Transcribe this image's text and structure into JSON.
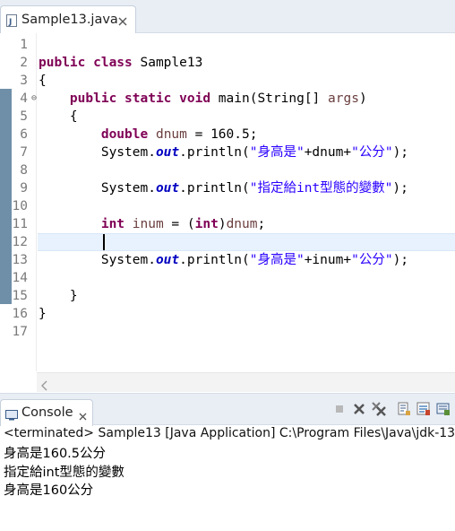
{
  "editor_tab": {
    "label": "Sample13.java",
    "icon": "java-file-icon",
    "close_icon": "close-icon"
  },
  "line_numbers": [
    "1",
    "2",
    "3",
    "4",
    "5",
    "6",
    "7",
    "8",
    "9",
    "10",
    "11",
    "12",
    "13",
    "14",
    "15",
    "16",
    "17"
  ],
  "code": {
    "l2_kw": "public class",
    "l2_name": " Sample13",
    "l3": "{",
    "l4_indent": "    ",
    "l4_kw": "public static void",
    "l4_rest1": " main(String[] ",
    "l4_args": "args",
    "l4_rest2": ")",
    "l5": "    {",
    "l6_indent": "        ",
    "l6_kw": "double",
    "l6_var": " dnum",
    "l6_rest": " = 160.5;",
    "l7_a": "        System.",
    "l7_field": "out",
    "l7_b": ".println(",
    "l7_str1": "\"身高是\"",
    "l7_c": "+dnum+",
    "l7_str2": "\"公分\"",
    "l7_d": ");",
    "l9_a": "        System.",
    "l9_field": "out",
    "l9_b": ".println(",
    "l9_str": "\"指定給int型態的變數\"",
    "l9_c": ");",
    "l11_indent": "        ",
    "l11_kw": "int",
    "l11_var": " inum",
    "l11_a": " = (",
    "l11_kw2": "int",
    "l11_b": ")",
    "l11_var2": "dnum",
    "l11_c": ";",
    "l13_a": "        System.",
    "l13_field": "out",
    "l13_b": ".println(",
    "l13_str1": "\"身高是\"",
    "l13_c": "+inum+",
    "l13_str2": "\"公分\"",
    "l13_d": ");",
    "l15": "    }",
    "l16": "}"
  },
  "console": {
    "tab_label": "Console",
    "header": "<terminated> Sample13 [Java Application] C:\\Program Files\\Java\\jdk-13",
    "output": [
      "身高是160.5公分",
      "指定給int型態的變數",
      "身高是160公分"
    ],
    "toolbar_icons": [
      "terminate-icon",
      "remove-launch-icon",
      "remove-all-terminated-icon",
      "scroll-lock-icon",
      "pin-console-icon",
      "display-selected-console-icon"
    ]
  },
  "colors": {
    "keyword": "#7f0055",
    "string": "#2a00ff",
    "field": "#0000c0",
    "local_var": "#6a3e3e",
    "change_bar": "#6f8fa8",
    "current_line": "#e8f2fe"
  }
}
